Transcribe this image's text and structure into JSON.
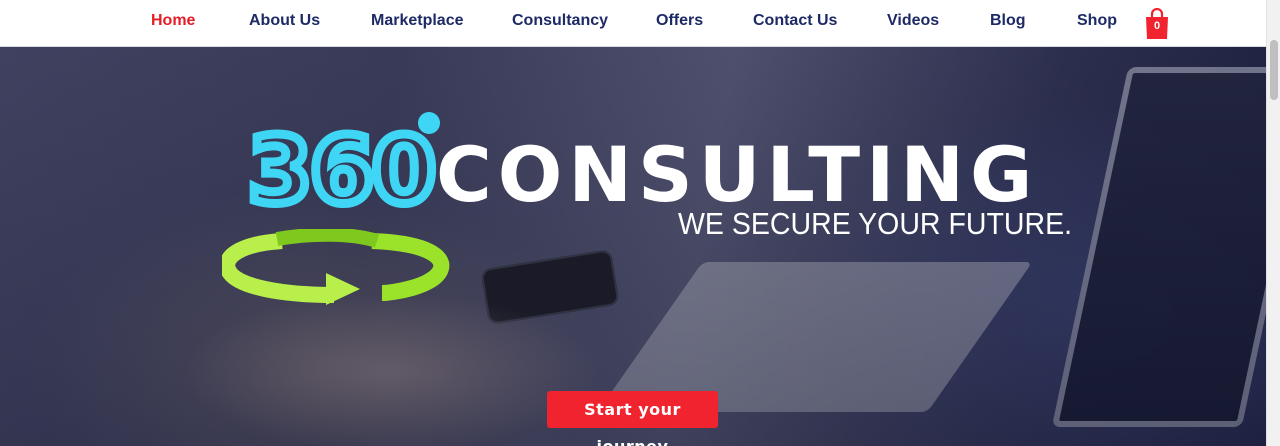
{
  "nav": {
    "items": [
      {
        "label": "Home",
        "active": true
      },
      {
        "label": "About Us",
        "active": false
      },
      {
        "label": "Marketplace",
        "active": false
      },
      {
        "label": "Consultancy",
        "active": false
      },
      {
        "label": "Offers",
        "active": false
      },
      {
        "label": "Contact Us",
        "active": false
      },
      {
        "label": "Videos",
        "active": false
      },
      {
        "label": "Blog",
        "active": false
      },
      {
        "label": "Shop",
        "active": false
      }
    ],
    "cart": {
      "count": "0",
      "icon": "shopping-bag-icon"
    }
  },
  "hero": {
    "brand_number": "360",
    "brand_word": "CONSULTING",
    "tagline": "WE SECURE YOUR FUTURE.",
    "cta_label": "Start your journey"
  },
  "colors": {
    "nav_text": "#1e2a66",
    "nav_active": "#e41e26",
    "brand_cyan": "#3fd6f5",
    "swirl_green": "#9be22a",
    "cta_red": "#f0232e"
  }
}
